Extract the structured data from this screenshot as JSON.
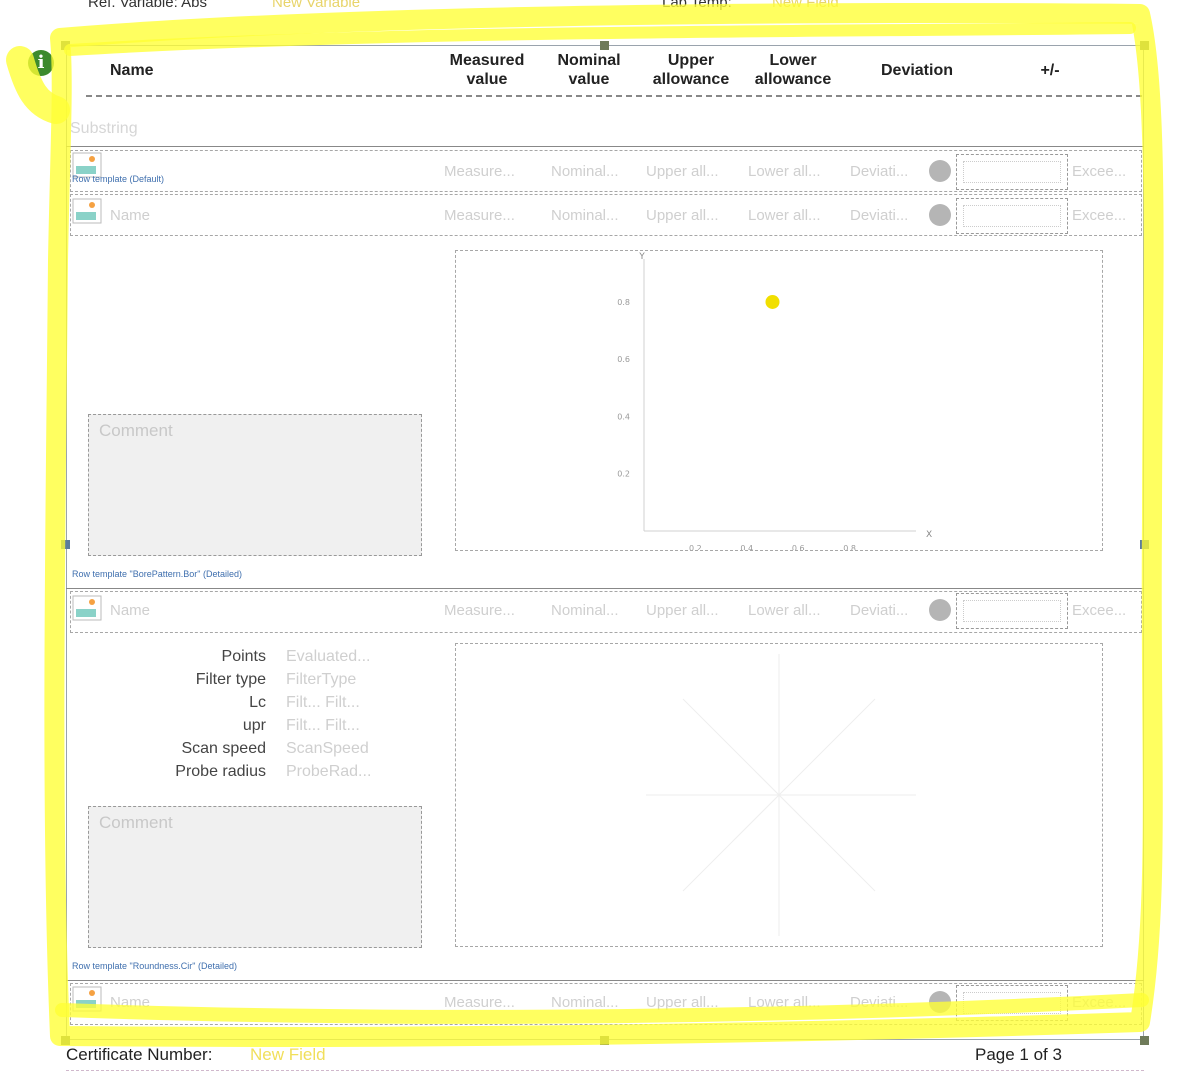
{
  "top_cut": {
    "left_label": "Ref. Variable: Abs",
    "left_value": "New Variable",
    "mid_label": "Lab Temp:",
    "mid_value": "New Field"
  },
  "info_button": {
    "glyph": "i"
  },
  "columns": {
    "name": "Name",
    "measured": [
      "Measured",
      "value"
    ],
    "nominal": [
      "Nominal",
      "value"
    ],
    "upper": [
      "Upper",
      "allowance"
    ],
    "lower": [
      "Lower",
      "allowance"
    ],
    "deviation": "Deviation",
    "tolerance": "+/-"
  },
  "substring": "Substring",
  "row_placeholders": {
    "name": "Name",
    "measured": "Measure...",
    "nominal": "Nominal...",
    "upper": "Upper all...",
    "lower": "Lower all...",
    "deviation": "Deviati...",
    "exceed": "Excee..."
  },
  "templates": {
    "default": "Row template (Default)",
    "bore": "Row template \"BorePattern.Bor\" (Detailed)",
    "round": "Row template \"Roundness.Cir\" (Detailed)"
  },
  "comment_placeholder": "Comment",
  "chart_data": {
    "type": "scatter",
    "xlabel": "X",
    "ylabel": "Y",
    "y_ticks": [
      "0.8",
      "0.6",
      "0.4",
      "0.2"
    ],
    "x_ticks": [
      "0.2",
      "0.4",
      "0.6",
      "0.8"
    ],
    "xlim": [
      0,
      1
    ],
    "ylim": [
      0,
      0.95
    ],
    "series": [
      {
        "x": [
          0.5
        ],
        "y": [
          0.8
        ]
      }
    ],
    "point_color": "#f1df00"
  },
  "params": [
    {
      "label": "Points",
      "value": "Evaluated..."
    },
    {
      "label": "Filter type",
      "value": "FilterType"
    },
    {
      "label": "Lc",
      "value": "Filt...  Filt..."
    },
    {
      "label": "upr",
      "value": "Filt...  Filt..."
    },
    {
      "label": "Scan speed",
      "value": "ScanSpeed"
    },
    {
      "label": "Probe radius",
      "value": "ProbeRad..."
    }
  ],
  "footer": {
    "cert_label": "Certificate Number:",
    "cert_value": "New Field",
    "page": "Page 1 of 3"
  },
  "colors": {
    "highlight": "#ffff33",
    "accent_green": "#3c8a2e",
    "template_blue": "#3f6fae"
  }
}
